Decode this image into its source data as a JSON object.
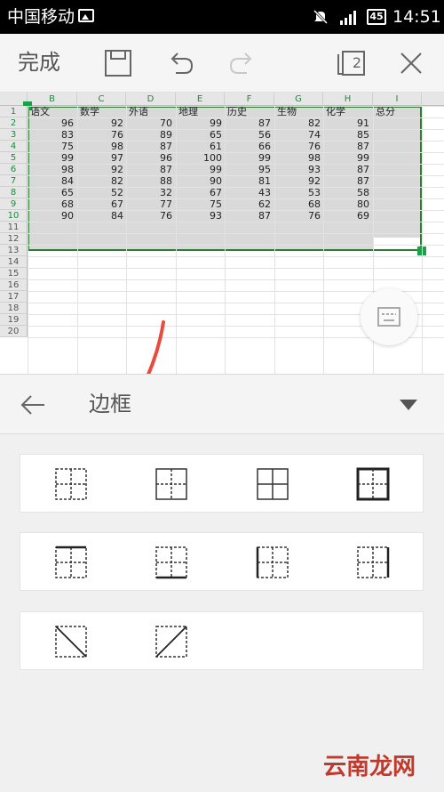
{
  "status_bar": {
    "carrier": "中国移动",
    "battery": "45",
    "time": "14:51"
  },
  "toolbar": {
    "done_label": "完成",
    "pages_count": "2"
  },
  "sheet": {
    "columns": [
      "B",
      "C",
      "D",
      "E",
      "F",
      "G",
      "H",
      "I"
    ],
    "rows": [
      "1",
      "2",
      "3",
      "4",
      "5",
      "6",
      "7",
      "8",
      "9",
      "10",
      "11",
      "12",
      "13",
      "14",
      "15",
      "16",
      "17",
      "18",
      "19",
      "20"
    ],
    "headers": [
      "语文",
      "数学",
      "外语",
      "地理",
      "历史",
      "生物",
      "化学",
      "总分"
    ],
    "data": [
      [
        "96",
        "92",
        "70",
        "99",
        "87",
        "82",
        "91"
      ],
      [
        "83",
        "76",
        "89",
        "65",
        "56",
        "74",
        "85"
      ],
      [
        "75",
        "98",
        "87",
        "61",
        "66",
        "76",
        "87"
      ],
      [
        "99",
        "97",
        "96",
        "100",
        "99",
        "98",
        "99"
      ],
      [
        "98",
        "92",
        "87",
        "99",
        "95",
        "93",
        "87"
      ],
      [
        "84",
        "82",
        "88",
        "90",
        "81",
        "92",
        "87"
      ],
      [
        "65",
        "52",
        "32",
        "67",
        "43",
        "53",
        "58"
      ],
      [
        "68",
        "67",
        "77",
        "75",
        "62",
        "68",
        "80"
      ],
      [
        "90",
        "84",
        "76",
        "93",
        "87",
        "76",
        "69"
      ]
    ]
  },
  "panel": {
    "title": "边框"
  },
  "border_options": [
    [
      "all-dashed",
      "outer-solid-inner-dashed",
      "all-solid",
      "thick-outer-inner-dashed"
    ],
    [
      "top-solid",
      "bottom-solid",
      "left-solid",
      "right-solid"
    ],
    [
      "diagonal-down",
      "diagonal-up"
    ]
  ],
  "watermark": "云南龙网"
}
